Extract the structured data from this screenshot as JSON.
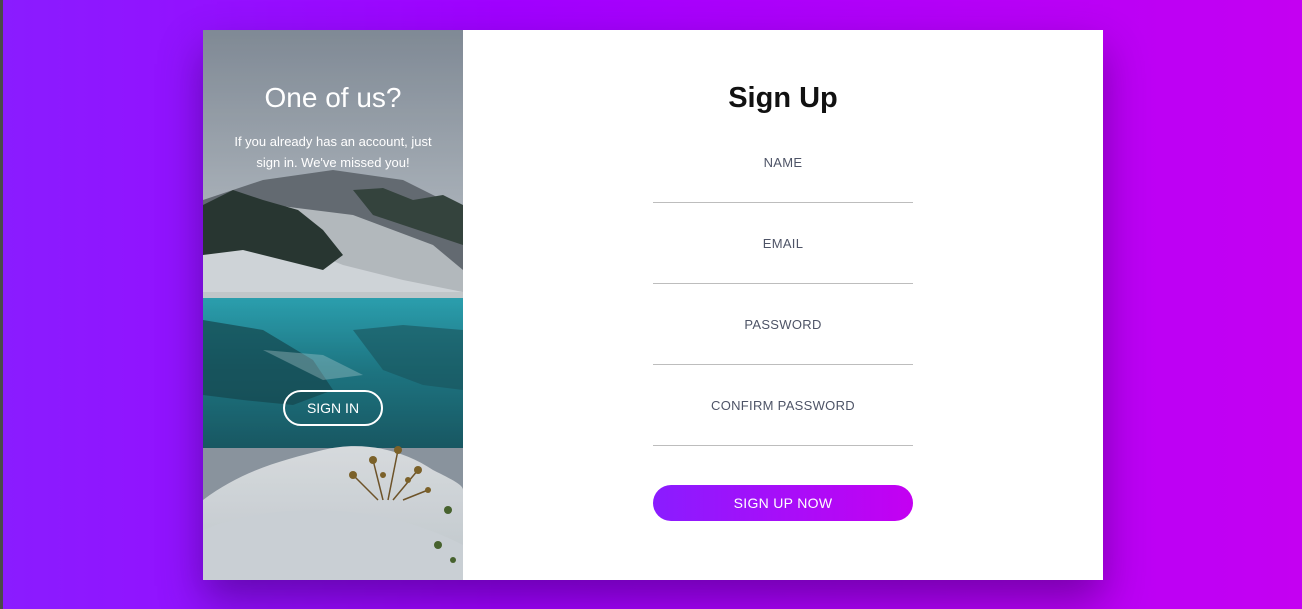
{
  "colors": {
    "gradient_start": "#8a1cff",
    "gradient_end": "#c400f2",
    "form_background": "#ffffff",
    "label_color": "#4e5467"
  },
  "image_panel": {
    "title": "One of us?",
    "text": "If you already has an account, just sign in. We've missed you!",
    "signin_label": "SIGN IN",
    "background_icon": "mountain-lake-photo"
  },
  "form": {
    "title": "Sign Up",
    "fields": [
      {
        "label": "NAME",
        "value": ""
      },
      {
        "label": "EMAIL",
        "value": ""
      },
      {
        "label": "PASSWORD",
        "value": ""
      },
      {
        "label": "CONFIRM PASSWORD",
        "value": ""
      }
    ],
    "submit_label": "SIGN UP NOW"
  }
}
